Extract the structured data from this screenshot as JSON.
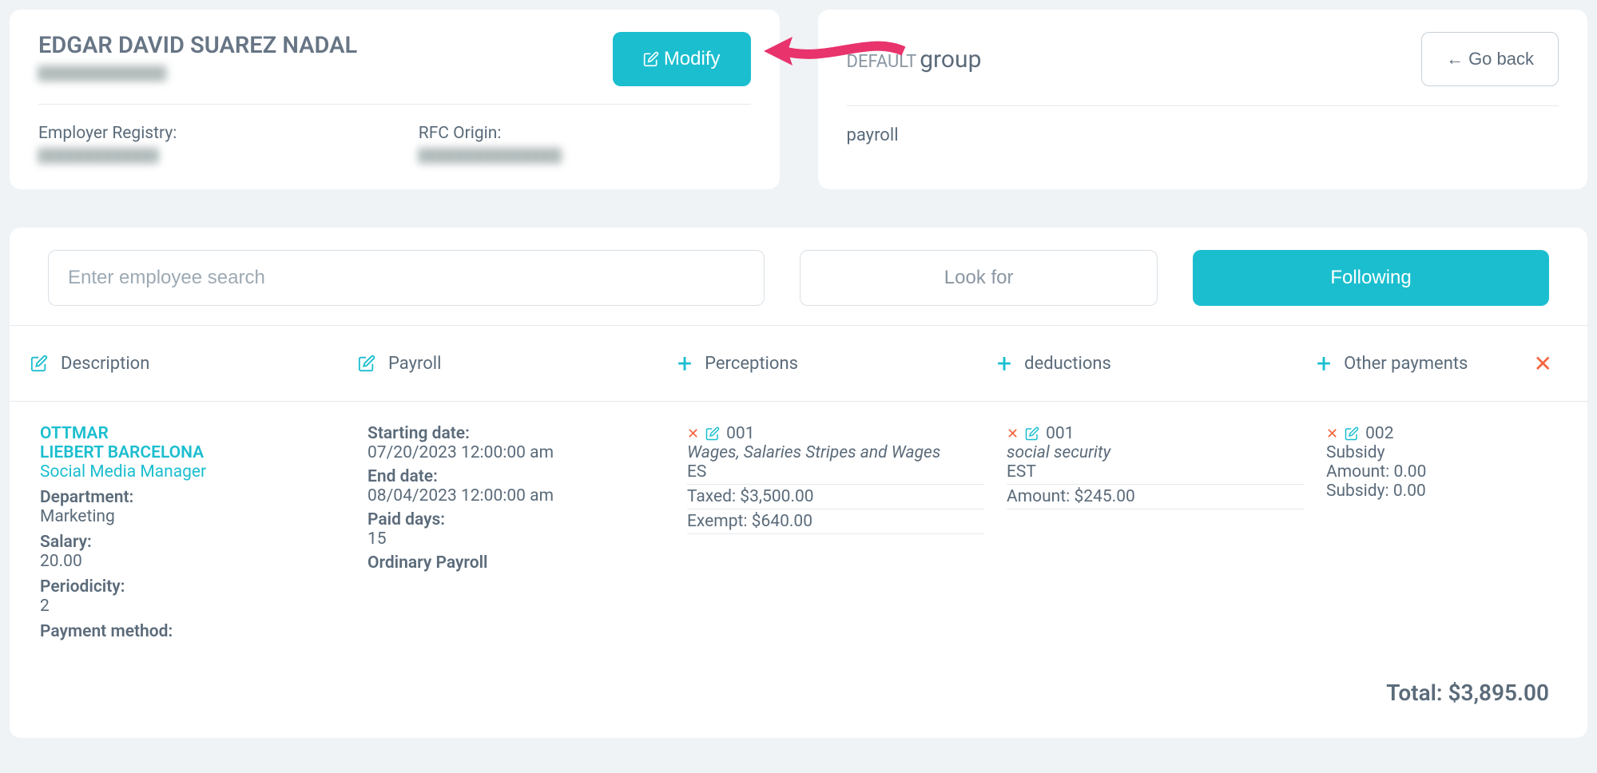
{
  "employee": {
    "name": "EDGAR DAVID SUAREZ NADAL",
    "modify_label": "Modify",
    "registry_label": "Employer Registry:",
    "rfc_label": "RFC Origin:"
  },
  "group": {
    "default_label": "DEFAULT",
    "group_word": "group",
    "go_back_label": "Go back",
    "payroll_word": "payroll"
  },
  "search": {
    "placeholder": "Enter employee search",
    "look_for": "Look for",
    "following": "Following"
  },
  "headers": {
    "description": "Description",
    "payroll": "Payroll",
    "perceptions": "Perceptions",
    "deductions": "deductions",
    "other_payments": "Other payments"
  },
  "row": {
    "desc": {
      "name_line1": "OTTMAR",
      "name_line2": "LIEBERT BARCELONA",
      "role": "Social Media Manager",
      "department_label": "Department:",
      "department": "Marketing",
      "salary_label": "Salary:",
      "salary": "20.00",
      "periodicity_label": "Periodicity:",
      "periodicity": "2",
      "pay_method_label": "Payment method:"
    },
    "payroll": {
      "start_label": "Starting date:",
      "start": "07/20/2023 12:00:00 am",
      "end_label": "End date:",
      "end": "08/04/2023 12:00:00 am",
      "paid_days_label": "Paid days:",
      "paid_days": "15",
      "type": "Ordinary Payroll"
    },
    "perception": {
      "code": "001",
      "desc": "Wages, Salaries Stripes and Wages",
      "es": "ES",
      "taxed_label": "Taxed:",
      "taxed": "$3,500.00",
      "exempt_label": "Exempt:",
      "exempt": "$640.00"
    },
    "deduction": {
      "code": "001",
      "desc": "social security",
      "est": "EST",
      "amount_label": "Amount:",
      "amount": "$245.00"
    },
    "other": {
      "code": "002",
      "desc": "Subsidy",
      "amount_label": "Amount:",
      "amount": "0.00",
      "subsidy_label": "Subsidy:",
      "subsidy": "0.00"
    }
  },
  "total": {
    "label": "Total:",
    "value": "$3,895.00"
  }
}
